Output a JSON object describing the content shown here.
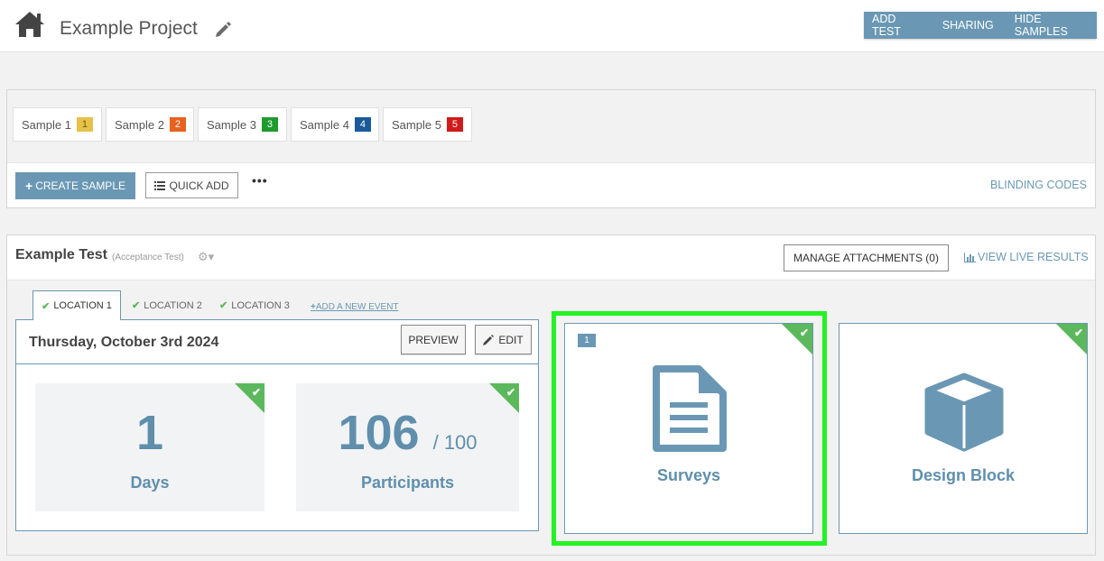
{
  "header": {
    "title": "Example Project",
    "actions": [
      "ADD TEST",
      "SHARING",
      "HIDE SAMPLES"
    ]
  },
  "samples": [
    {
      "label": "Sample 1",
      "num": "1",
      "color": "#e7c14a"
    },
    {
      "label": "Sample 2",
      "num": "2",
      "color": "#e8621f"
    },
    {
      "label": "Sample 3",
      "num": "3",
      "color": "#1f9a2e"
    },
    {
      "label": "Sample 4",
      "num": "4",
      "color": "#1b5a9a"
    },
    {
      "label": "Sample 5",
      "num": "5",
      "color": "#d11a1a"
    }
  ],
  "samples_toolbar": {
    "create": "CREATE SAMPLE",
    "quick_add": "QUICK ADD",
    "more": "•••",
    "blinding": "BLINDING CODES"
  },
  "test": {
    "title": "Example Test",
    "subtitle": "(Acceptance Test)",
    "attachments": "MANAGE ATTACHMENTS (0)",
    "live_results": "VIEW LIVE RESULTS",
    "tabs": [
      "LOCATION 1",
      "LOCATION 2",
      "LOCATION 3"
    ],
    "add_event": "ADD A NEW EVENT",
    "event": {
      "date": "Thursday, October 3rd 2024",
      "preview": "PREVIEW",
      "edit": "EDIT",
      "days_value": "1",
      "days_label": "Days",
      "participants_value": "106",
      "participants_total": "/ 100",
      "participants_label": "Participants"
    }
  },
  "cards": {
    "surveys": {
      "label": "Surveys",
      "count": "1"
    },
    "design": {
      "label": "Design Block"
    }
  },
  "colors": {
    "accent": "#6a98b4",
    "check": "#5cb85c",
    "highlight": "#24f224"
  }
}
